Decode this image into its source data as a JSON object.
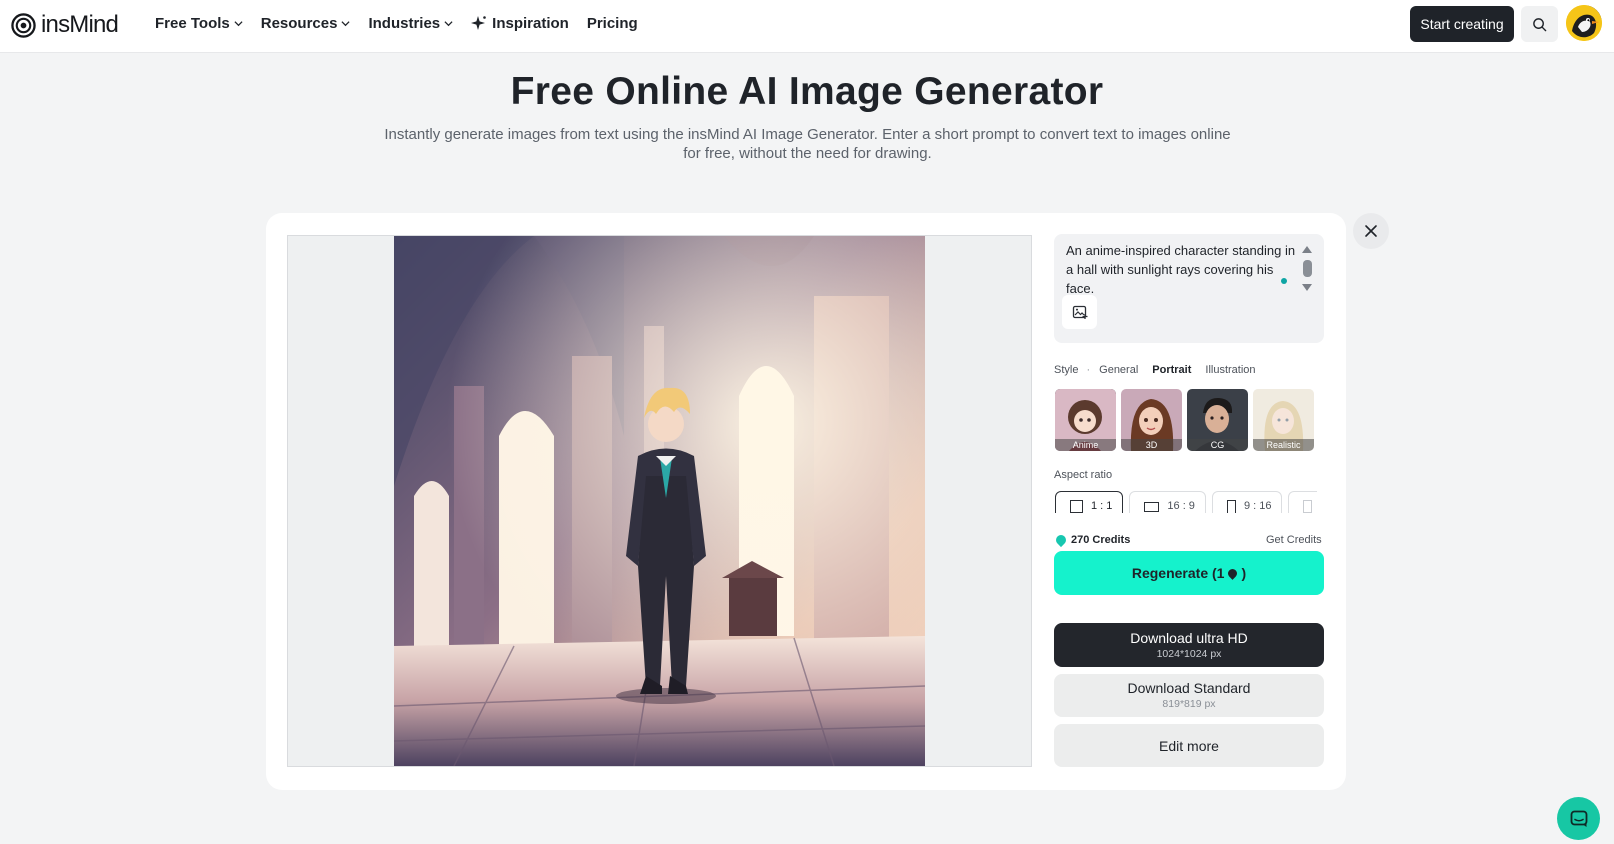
{
  "header": {
    "brand": "insMind",
    "nav": [
      {
        "label": "Free Tools",
        "dropdown": true
      },
      {
        "label": "Resources",
        "dropdown": true
      },
      {
        "label": "Industries",
        "dropdown": true
      },
      {
        "label": "Inspiration",
        "dropdown": false
      },
      {
        "label": "Pricing",
        "dropdown": false
      }
    ],
    "cta_label": "Start creating",
    "icons": {
      "search": "search-icon",
      "avatar": "user-avatar"
    }
  },
  "hero": {
    "title": "Free Online AI Image Generator",
    "subtitle": "Instantly generate images from text using the insMind AI Image Generator. Enter a short prompt to convert text to images online for free, without the need for drawing."
  },
  "panel": {
    "prompt": "An anime-inspired character standing in a hall with sunlight rays covering his face.",
    "style_label": "Style",
    "style_tabs": [
      {
        "label": "General",
        "active": false
      },
      {
        "label": "Portrait",
        "active": true
      },
      {
        "label": "Illustration",
        "active": false
      }
    ],
    "styles": [
      {
        "label": "Anime",
        "selected": true
      },
      {
        "label": "3D",
        "selected": false
      },
      {
        "label": "CG",
        "selected": false
      },
      {
        "label": "Realistic",
        "selected": false
      }
    ],
    "aspect_label": "Aspect ratio",
    "ratios": [
      {
        "label": "1 : 1",
        "selected": true
      },
      {
        "label": "16 : 9",
        "selected": false
      },
      {
        "label": "9 : 16",
        "selected": false
      }
    ],
    "credits": "270 Credits",
    "get_credits": "Get Credits",
    "regenerate": "Regenerate (1",
    "regenerate_end": ")",
    "download_hd": {
      "label": "Download ultra HD",
      "size": "1024*1024 px"
    },
    "download_std": {
      "label": "Download Standard",
      "size": "819*819 px"
    },
    "edit_more": "Edit more"
  },
  "colors": {
    "accent": "#15f2cc",
    "dark": "#23262c",
    "teal": "#17c7a4"
  }
}
